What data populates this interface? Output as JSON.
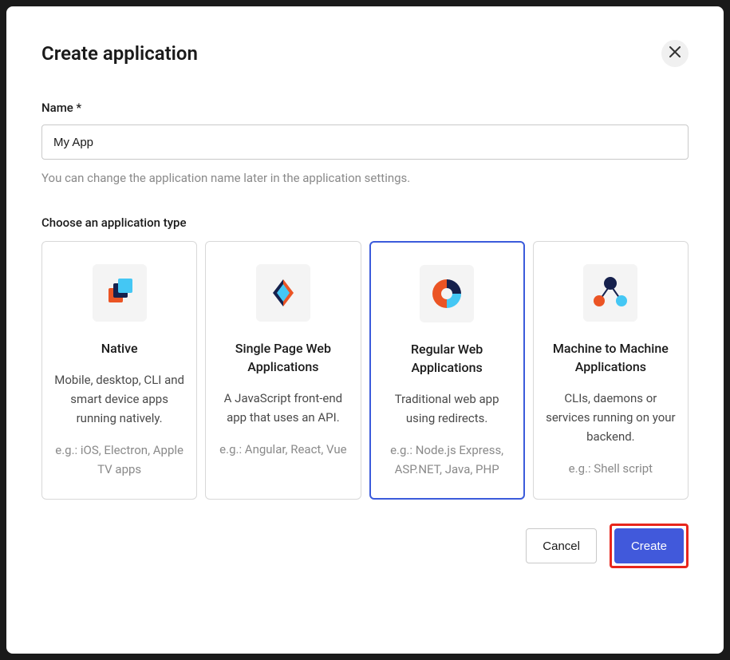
{
  "modal": {
    "title": "Create application"
  },
  "nameField": {
    "label": "Name *",
    "value": "My App",
    "hint": "You can change the application name later in the application settings."
  },
  "typeSection": {
    "label": "Choose an application type"
  },
  "cards": [
    {
      "title": "Native",
      "desc": "Mobile, desktop, CLI and smart device apps running natively.",
      "examples": "e.g.: iOS, Electron, Apple TV apps"
    },
    {
      "title": "Single Page Web Applications",
      "desc": "A JavaScript front-end app that uses an API.",
      "examples": "e.g.: Angular, React, Vue"
    },
    {
      "title": "Regular Web Applications",
      "desc": "Traditional web app using redirects.",
      "examples": "e.g.: Node.js Express, ASP.NET, Java, PHP"
    },
    {
      "title": "Machine to Machine Applications",
      "desc": "CLIs, daemons or services running on your backend.",
      "examples": "e.g.: Shell script"
    }
  ],
  "footer": {
    "cancel": "Cancel",
    "create": "Create"
  }
}
